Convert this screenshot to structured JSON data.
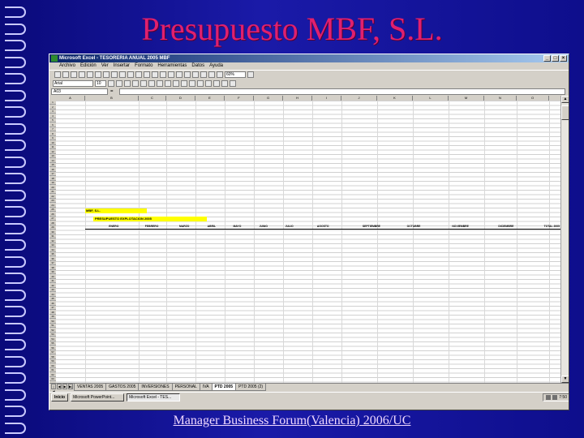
{
  "slide": {
    "title": "Presupuesto MBF, S.L.",
    "footer": "Manager Business Forum(Valencia) 2006/UC"
  },
  "window": {
    "title": "Microsoft Excel - TESORERIA ANUAL 2005 MBF",
    "menus": [
      "Archivo",
      "Edición",
      "Ver",
      "Insertar",
      "Formato",
      "Herramientas",
      "Datos",
      "Ayuda"
    ],
    "zoom": "60%",
    "font": "Arial",
    "font_size": "10",
    "namebox": "A03"
  },
  "sheet": {
    "columns": [
      "A",
      "B",
      "C",
      "D",
      "E",
      "F",
      "G",
      "H",
      "I",
      "J",
      "K",
      "L",
      "M",
      "N",
      "O"
    ],
    "label_company": "MBF, S.L.",
    "label_budget": "PRESUPUESTO EXPLOTACION 2005",
    "headers": [
      "",
      "ENERO",
      "FEBRERO",
      "MARZO",
      "ABRIL",
      "MAYO",
      "JUNIO",
      "JULIO",
      "AGOSTO",
      "SEPTIEMBRE",
      "OCTUBRE",
      "NOVIEMBRE",
      "DICIEMBRE",
      "TOTAL 2005"
    ]
  },
  "tabs": [
    "VENTAS 2005",
    "GASTOS 2005",
    "INVERSIONES",
    "PERSONAL",
    "IVA",
    "PTD 2005",
    "PTD 2005 (2)"
  ],
  "active_tab": "PTD 2005",
  "taskbar": {
    "start": "Inicio",
    "buttons": [
      "Microsoft PowerPoint...",
      "Microsoft Excel - TES..."
    ],
    "clock": "7:50"
  }
}
